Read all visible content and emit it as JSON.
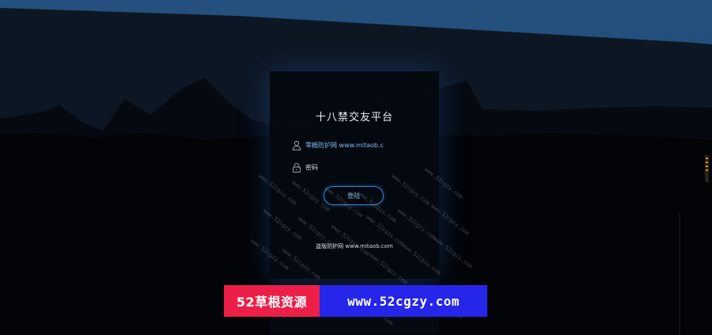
{
  "app": {
    "title": "十八禁交友平台"
  },
  "login": {
    "username_value": "零概防护网 www.mitaob.c",
    "password_placeholder": "密码",
    "submit_label": "登陆",
    "footer_text": "盗版防护网 www.mitaob.com"
  },
  "watermark": {
    "text": "www.52cgzy.com"
  },
  "banner": {
    "left_label": "52草根资源",
    "right_label": "www.52cgzy.com",
    "left_color": "#ec1f49",
    "right_color": "#2626ea"
  },
  "colors": {
    "sky": "#234f80",
    "panel_glow": "#265aaa",
    "accent": "#3a7fd6",
    "side_strip_marks": "#d98a22"
  },
  "icons": {
    "username": "user-icon",
    "password": "lock-icon"
  }
}
